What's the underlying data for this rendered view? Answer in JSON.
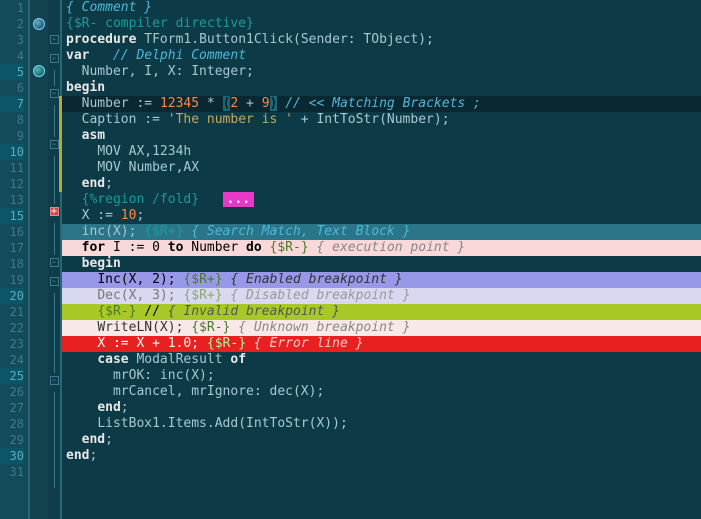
{
  "lines": [
    {
      "n": "1",
      "fold": "",
      "html": "<span class='c-comment'>{ Comment }</span>"
    },
    {
      "n": "2",
      "fold": "",
      "html": "<span class='c-dir'>{$R- compiler directive}</span>"
    },
    {
      "n": "3",
      "fold": "box",
      "html": "<span class='c-key'>procedure</span> <span class='c-ident'>TForm1.Button1Click(Sender: TObject);</span>"
    },
    {
      "n": "4",
      "fold": "box",
      "html": "<span class='c-key'>var</span>   <span class='c-comment'>// Delphi Comment</span>"
    },
    {
      "n": "5",
      "hl": true,
      "fold": "line",
      "html": "  <span class='c-ident'>Number, I, X: Integer;</span>"
    },
    {
      "n": "6",
      "fold": "box",
      "html": "<span class='c-key'>begin</span>"
    },
    {
      "n": "7",
      "hl": true,
      "fold": "line",
      "bg": "hl-cur",
      "mod": "y",
      "html": "  <span class='c-ident'>Number := </span><span class='c-num'>12345</span><span class='c-ident'> * </span><span class='c-paren-match'>(</span><span class='c-num'>2</span><span class='c-ident'> + </span><span class='c-num'>9</span><span class='c-paren-match'>)</span> <span class='c-comment'>// &lt;&lt; Matching Brackets ;</span>"
    },
    {
      "n": "8",
      "fold": "line",
      "mod": "y",
      "html": "  <span class='c-ident'>Caption := </span><span class='c-str'>'The number is '</span><span class='c-ident'> + IntToStr(Number);</span>"
    },
    {
      "n": "9",
      "fold": "box",
      "mod": "y",
      "html": "  <span class='c-key'>asm</span>"
    },
    {
      "n": "10",
      "hl": true,
      "fold": "line",
      "mod": "y",
      "html": "    <span class='c-ident'>MOV AX,1234h</span>"
    },
    {
      "n": "11",
      "fold": "line",
      "mod": "y",
      "html": "    <span class='c-ident'>MOV Number,AX</span>"
    },
    {
      "n": "12",
      "fold": "line",
      "mod": "y",
      "html": "  <span class='c-key'>end</span><span class='c-ident'>;</span>"
    },
    {
      "n": "13",
      "fold": "plus",
      "html": "  <span class='c-dir'>{%region /fold}</span>   <span class='badge'>...</span>"
    },
    {
      "n": "15",
      "hl": true,
      "fold": "line",
      "html": "  <span class='c-ident'>X := </span><span class='c-num'>10</span><span class='c-ident'>;</span>"
    },
    {
      "n": "16",
      "fold": "line",
      "bg": "hl-search",
      "html": "  <span class='c-ident'>inc(X);</span> <span class='c-dir'>{$R+}</span> <span class='c-comment'>{ Search Match, Text Block }</span>"
    },
    {
      "n": "17",
      "fold": "box",
      "bg": "hl-exec",
      "html": "  <span class='c-key'>for</span> I := 0 <span class='c-key'>to</span> Number <span class='c-key'>do</span> <span class='c-dir'>{$R-}</span> <span class='c-comment'>{ execution point }</span>"
    },
    {
      "n": "18",
      "fold": "box",
      "html": "  <span class='c-key'>begin</span>"
    },
    {
      "n": "19",
      "fold": "line",
      "bg": "hl-enable-bp",
      "html": "    <span class='c-ident'>Inc(X, 2);</span> <span class='c-dir'>{$R+}</span> <span class='c-comment'>{ Enabled breakpoint }</span>"
    },
    {
      "n": "20",
      "hl": true,
      "fold": "line",
      "bg": "hl-disable-bp",
      "html": "    <span class='c-ident'>Dec(X, 3);</span> <span class='c-dir'>{$R+}</span> <span class='c-comment'>{ Disabled breakpoint }</span>"
    },
    {
      "n": "21",
      "fold": "line",
      "bg": "hl-invalid-bp",
      "html": "    <span class='c-dir'>{$R-}</span> // <span class='c-comment'>{ Invalid breakpoint }</span>"
    },
    {
      "n": "22",
      "fold": "line",
      "bg": "hl-unknown-bp",
      "html": "    <span class='c-ident'>WriteLN(X);</span> <span class='c-dir'>{$R-}</span> <span class='c-comment'>{ Unknown breakpoint }</span>"
    },
    {
      "n": "23",
      "fold": "line",
      "bg": "hl-error",
      "html": "    <span class='c-ident'>X := X + 1.0;</span> <span class='c-dir'>{$R-}</span> <span class='c-comment'>{ Error line }</span>"
    },
    {
      "n": "24",
      "fold": "box",
      "html": "    <span class='c-key'>case</span> <span class='c-ident'>ModalResult</span> <span class='c-key'>of</span>"
    },
    {
      "n": "25",
      "hl": true,
      "fold": "line",
      "html": "      <span class='c-ident'>mrOK: inc(X);</span>"
    },
    {
      "n": "26",
      "fold": "line",
      "html": "      <span class='c-ident'>mrCancel, mrIgnore: dec(X);</span>"
    },
    {
      "n": "27",
      "fold": "line",
      "html": "    <span class='c-key'>end</span><span class='c-ident'>;</span>"
    },
    {
      "n": "28",
      "fold": "line",
      "html": "    <span class='c-ident'>ListBox1.Items.Add(IntToStr(X));</span>"
    },
    {
      "n": "29",
      "fold": "line",
      "html": "  <span class='c-key'>end</span><span class='c-ident'>;</span>"
    },
    {
      "n": "30",
      "hl": true,
      "fold": "line",
      "html": "<span class='c-key'>end</span><span class='c-ident'>;</span>"
    },
    {
      "n": "31",
      "fold": "",
      "html": ""
    }
  ]
}
